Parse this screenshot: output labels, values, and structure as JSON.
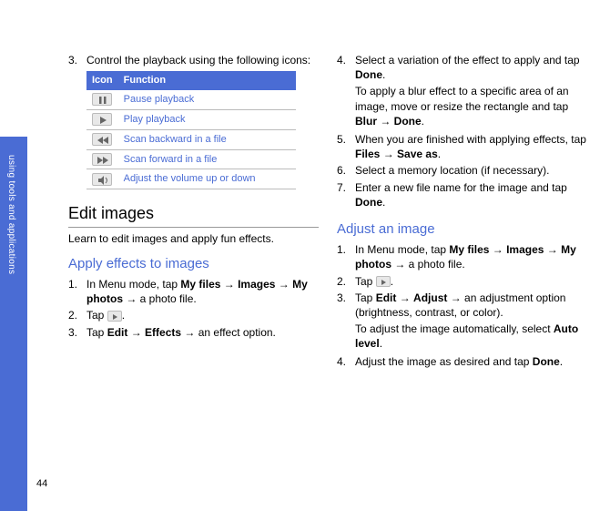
{
  "sidebar_label": "using tools and applications",
  "page_number": "44",
  "col1": {
    "item3_num": "3.",
    "item3_text": "Control the playback using the following icons:",
    "table": {
      "h_icon": "Icon",
      "h_func": "Function",
      "rows": [
        {
          "icon": "pause-icon",
          "func": "Pause playback"
        },
        {
          "icon": "play-icon",
          "func": "Play playback"
        },
        {
          "icon": "rewind-icon",
          "func": "Scan backward in a file"
        },
        {
          "icon": "ffwd-icon",
          "func": "Scan forward in a file"
        },
        {
          "icon": "volume-icon",
          "func": "Adjust the volume up or down"
        }
      ]
    },
    "h2": "Edit images",
    "lead": "Learn to edit images and apply fun effects.",
    "h3": "Apply effects to images",
    "s1_num": "1.",
    "s1_a": "In Menu mode, tap ",
    "s1_b": "My files",
    "s1_c": " → ",
    "s1_d": "Images",
    "s1_e": " → ",
    "s1_f": "My photos",
    "s1_g": " → a photo file.",
    "s2_num": "2.",
    "s2_a": "Tap ",
    "s2_b": ".",
    "s3_num": "3.",
    "s3_a": "Tap ",
    "s3_b": "Edit",
    "s3_c": " → ",
    "s3_d": "Effects",
    "s3_e": " → an effect option."
  },
  "col2": {
    "s4_num": "4.",
    "s4_a": "Select a variation of the effect to apply and tap ",
    "s4_b": "Done",
    "s4_c": ".",
    "s4_sub_a": "To apply a blur effect to a specific area of an image, move or resize the rectangle and tap ",
    "s4_sub_b": "Blur",
    "s4_sub_c": " → ",
    "s4_sub_d": "Done",
    "s4_sub_e": ".",
    "s5_num": "5.",
    "s5_a": "When you are finished with applying effects, tap ",
    "s5_b": "Files",
    "s5_c": " → ",
    "s5_d": "Save as",
    "s5_e": ".",
    "s6_num": "6.",
    "s6_a": "Select a memory location (if necessary).",
    "s7_num": "7.",
    "s7_a": "Enter a new file name for the image and tap ",
    "s7_b": "Done",
    "s7_c": ".",
    "h3": "Adjust an image",
    "a1_num": "1.",
    "a1_a": "In Menu mode, tap ",
    "a1_b": "My files",
    "a1_c": " → ",
    "a1_d": "Images",
    "a1_e": " → ",
    "a1_f": "My photos",
    "a1_g": " → a photo file.",
    "a2_num": "2.",
    "a2_a": "Tap ",
    "a2_b": ".",
    "a3_num": "3.",
    "a3_a": "Tap ",
    "a3_b": "Edit",
    "a3_c": " → ",
    "a3_d": "Adjust",
    "a3_e": " → an adjustment option (brightness, contrast, or color).",
    "a3_sub_a": "To adjust the image automatically, select ",
    "a3_sub_b": "Auto level",
    "a3_sub_c": ".",
    "a4_num": "4.",
    "a4_a": "Adjust the image as desired and tap ",
    "a4_b": "Done",
    "a4_c": "."
  }
}
